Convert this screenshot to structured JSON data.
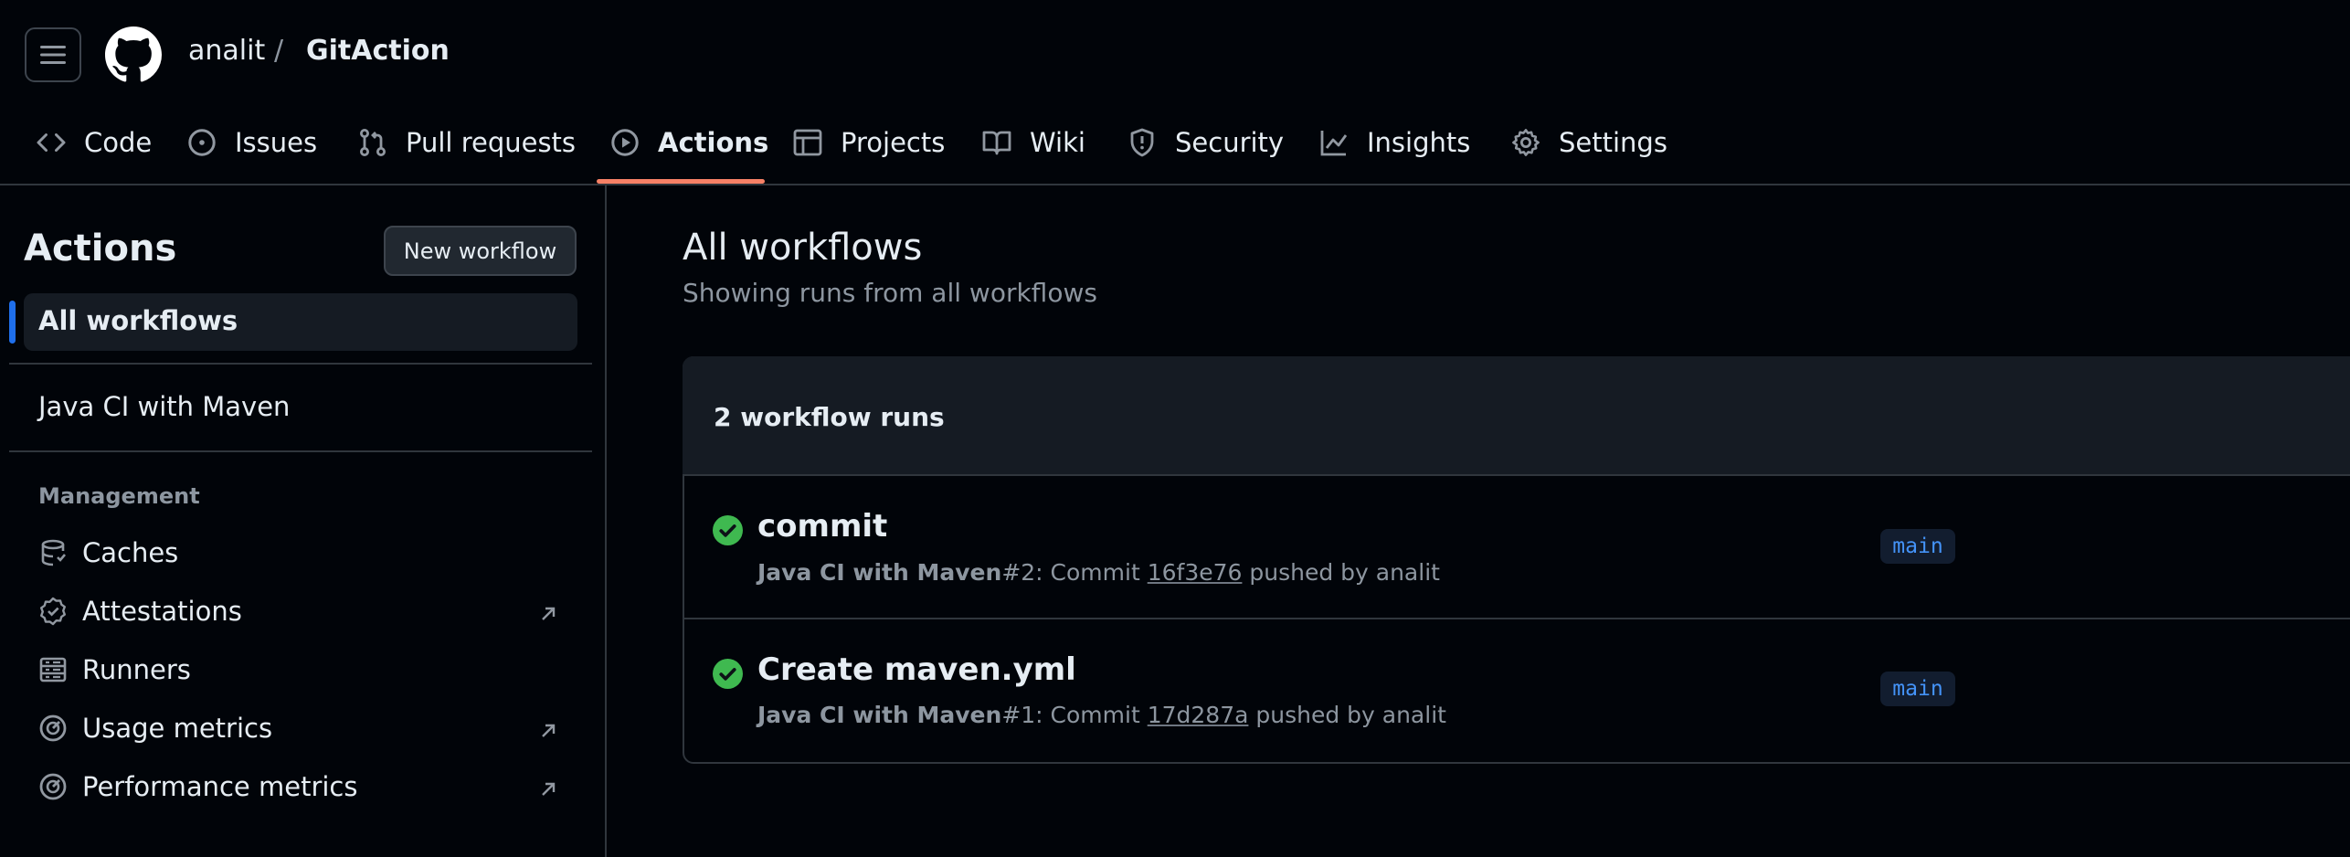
{
  "header": {
    "owner": "analit",
    "separator": "/",
    "repo": "GitAction"
  },
  "nav": {
    "tabs": [
      {
        "label": "Code",
        "icon": "code-icon"
      },
      {
        "label": "Issues",
        "icon": "issue-icon"
      },
      {
        "label": "Pull requests",
        "icon": "pull-request-icon"
      },
      {
        "label": "Actions",
        "icon": "play-icon",
        "active": true
      },
      {
        "label": "Projects",
        "icon": "table-icon"
      },
      {
        "label": "Wiki",
        "icon": "book-icon"
      },
      {
        "label": "Security",
        "icon": "shield-icon"
      },
      {
        "label": "Insights",
        "icon": "graph-icon"
      },
      {
        "label": "Settings",
        "icon": "gear-icon"
      }
    ]
  },
  "sidebar": {
    "title": "Actions",
    "new_workflow": "New workflow",
    "all_workflows": "All workflows",
    "workflows": [
      "Java CI with Maven"
    ],
    "management_heading": "Management",
    "management_items": [
      {
        "label": "Caches",
        "icon": "database-icon",
        "external": false
      },
      {
        "label": "Attestations",
        "icon": "verified-icon",
        "external": true
      },
      {
        "label": "Runners",
        "icon": "server-icon",
        "external": false
      },
      {
        "label": "Usage metrics",
        "icon": "meter-icon",
        "external": true
      },
      {
        "label": "Performance metrics",
        "icon": "meter-icon",
        "external": true
      }
    ]
  },
  "main": {
    "title": "All workflows",
    "subtitle": "Showing runs from all workflows",
    "runs_count": "2 workflow runs",
    "runs": [
      {
        "title": "commit",
        "workflow": "Java CI with Maven",
        "run_number": "#2",
        "event_text": ": Commit ",
        "sha": "16f3e76",
        "pushed_by": " pushed by analit",
        "branch": "main",
        "status": "success"
      },
      {
        "title": "Create maven.yml",
        "workflow": "Java CI with Maven",
        "run_number": "#1",
        "event_text": ": Commit ",
        "sha": "17d287a",
        "pushed_by": " pushed by analit",
        "branch": "main",
        "status": "success"
      }
    ]
  },
  "colors": {
    "background": "#010409",
    "border": "#30363d",
    "accent_underline": "#f78166",
    "success": "#3fb950",
    "link_blue": "#4493f8",
    "selected_bar": "#1f6feb"
  }
}
